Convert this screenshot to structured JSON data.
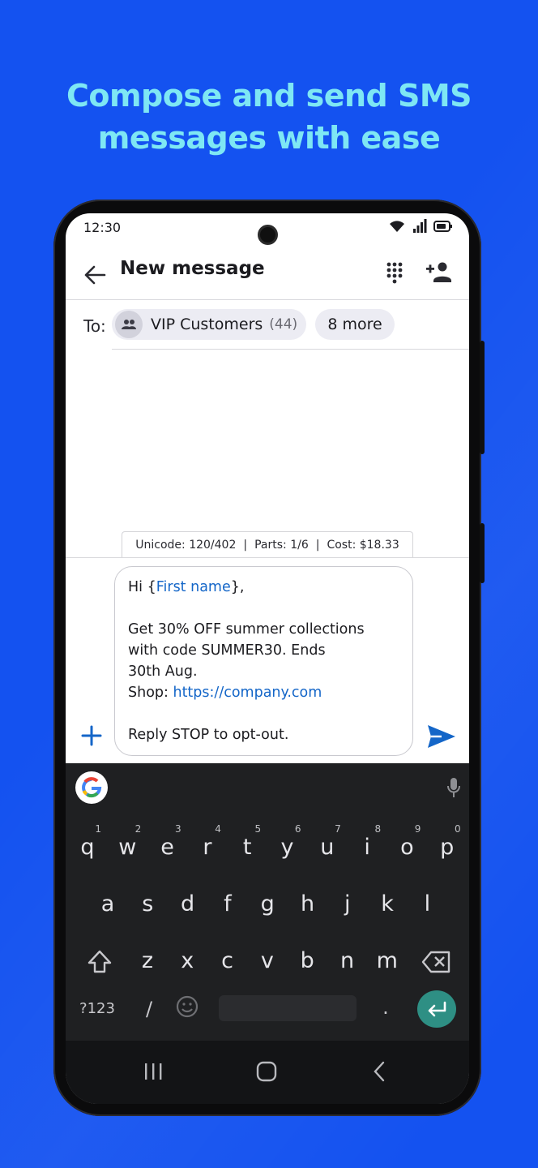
{
  "headline": {
    "line1": "Compose and send SMS",
    "line2": "messages with ease"
  },
  "status": {
    "time": "12:30",
    "icons": [
      "wifi-icon",
      "signal-icon",
      "battery-icon"
    ]
  },
  "appbar": {
    "title": "New message",
    "back_icon": "arrow-left-icon",
    "dialpad_icon": "dialpad-icon",
    "add_contact_icon": "add-person-icon"
  },
  "recipients": {
    "to_label": "To:",
    "group": {
      "name": "VIP Customers",
      "count": "(44)",
      "icon": "group-icon"
    },
    "more": "8 more"
  },
  "stats": {
    "unicode": "Unicode: 120/402",
    "parts": "Parts: 1/6",
    "cost": "Cost: $18.33",
    "separator": "|"
  },
  "message": {
    "line1_prefix": "Hi {",
    "line1_var": "First name",
    "line1_suffix": "},",
    "line2": "Get 30% OFF summer collections",
    "line3": "with code SUMMER30. Ends",
    "line4": "30th Aug.",
    "line5_prefix": "Shop: ",
    "line5_link": "https://company.com",
    "line6": "Reply STOP to opt-out."
  },
  "composer": {
    "attach_icon": "plus-icon",
    "send_icon": "send-icon"
  },
  "keyboard": {
    "row1": [
      {
        "k": "q",
        "n": "1"
      },
      {
        "k": "w",
        "n": "2"
      },
      {
        "k": "e",
        "n": "3"
      },
      {
        "k": "r",
        "n": "4"
      },
      {
        "k": "t",
        "n": "5"
      },
      {
        "k": "y",
        "n": "6"
      },
      {
        "k": "u",
        "n": "7"
      },
      {
        "k": "i",
        "n": "8"
      },
      {
        "k": "o",
        "n": "9"
      },
      {
        "k": "p",
        "n": "0"
      }
    ],
    "row2": [
      "a",
      "s",
      "d",
      "f",
      "g",
      "h",
      "j",
      "k",
      "l"
    ],
    "row3": [
      "z",
      "x",
      "c",
      "v",
      "b",
      "n",
      "m"
    ],
    "sym_label": "?123",
    "slash": "/",
    "period": ".",
    "icons": [
      "google-icon",
      "mic-icon",
      "shift-icon",
      "backspace-icon",
      "emoji-icon",
      "enter-icon"
    ]
  },
  "navbar": {
    "icons": [
      "recents-icon",
      "home-icon",
      "back-nav-icon"
    ]
  }
}
